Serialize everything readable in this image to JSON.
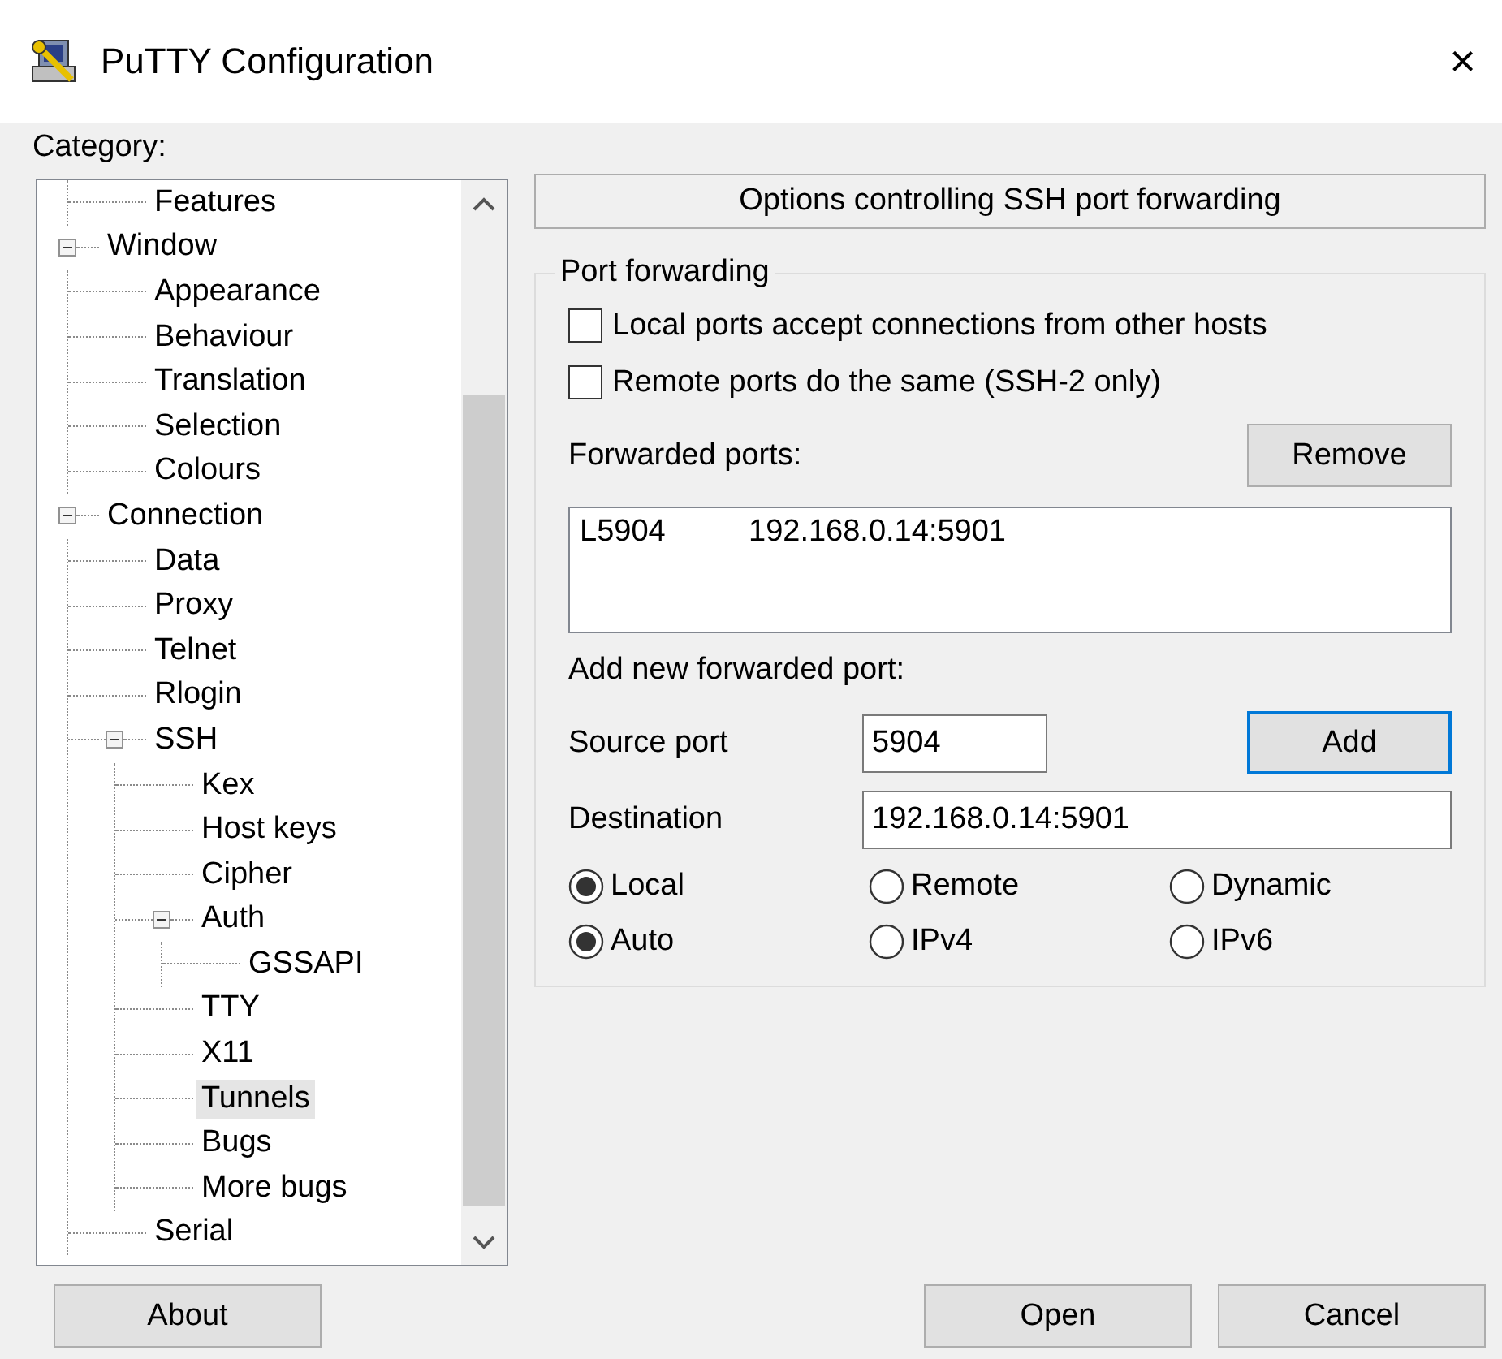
{
  "window": {
    "title": "PuTTY Configuration",
    "close": "×"
  },
  "category_label": "Category:",
  "tree": {
    "items": [
      {
        "children": [
          {
            "label": "Features",
            "selected": false
          }
        ]
      },
      {
        "label": "Window",
        "expanded": true,
        "selected": false,
        "children": [
          {
            "label": "Appearance",
            "selected": false
          },
          {
            "label": "Behaviour",
            "selected": false
          },
          {
            "label": "Translation",
            "selected": false
          },
          {
            "label": "Selection",
            "selected": false
          },
          {
            "label": "Colours",
            "selected": false
          }
        ]
      },
      {
        "label": "Connection",
        "expanded": true,
        "selected": false,
        "children": [
          {
            "label": "Data",
            "selected": false
          },
          {
            "label": "Proxy",
            "selected": false
          },
          {
            "label": "Telnet",
            "selected": false
          },
          {
            "label": "Rlogin",
            "selected": false
          },
          {
            "label": "SSH",
            "expanded": true,
            "selected": false,
            "children": [
              {
                "label": "Kex",
                "selected": false
              },
              {
                "label": "Host keys",
                "selected": false
              },
              {
                "label": "Cipher",
                "selected": false
              },
              {
                "label": "Auth",
                "expanded": true,
                "selected": false,
                "children": [
                  {
                    "label": "GSSAPI",
                    "selected": false
                  }
                ]
              },
              {
                "label": "TTY",
                "selected": false
              },
              {
                "label": "X11",
                "selected": false
              },
              {
                "label": "Tunnels",
                "selected": true
              },
              {
                "label": "Bugs",
                "selected": false
              },
              {
                "label": "More bugs",
                "selected": false
              }
            ]
          },
          {
            "label": "Serial",
            "selected": false
          }
        ]
      }
    ]
  },
  "panel": {
    "header": "Options controlling SSH port forwarding",
    "group": {
      "title": "Port forwarding",
      "options": [
        {
          "label": "Local ports accept connections from other hosts",
          "checked": false
        },
        {
          "label": "Remote ports do the same (SSH-2 only)",
          "checked": false
        }
      ],
      "forwarded_label": "Forwarded ports:",
      "remove_button": "Remove",
      "forwarded_ports": [
        {
          "source": "L5904",
          "destination": "192.168.0.14:5901"
        }
      ],
      "add_label": "Add new forwarded port:",
      "source_port": {
        "label": "Source port",
        "value": "5904"
      },
      "add_button": "Add",
      "destination": {
        "label": "Destination",
        "value": "192.168.0.14:5901"
      },
      "direction": [
        {
          "label": "Local",
          "selected": true
        },
        {
          "label": "Remote",
          "selected": false
        },
        {
          "label": "Dynamic",
          "selected": false
        }
      ],
      "protocol": [
        {
          "label": "Auto",
          "selected": true
        },
        {
          "label": "IPv4",
          "selected": false
        },
        {
          "label": "IPv6",
          "selected": false
        }
      ]
    }
  },
  "buttons": {
    "about": "About",
    "open": "Open",
    "cancel": "Cancel"
  }
}
